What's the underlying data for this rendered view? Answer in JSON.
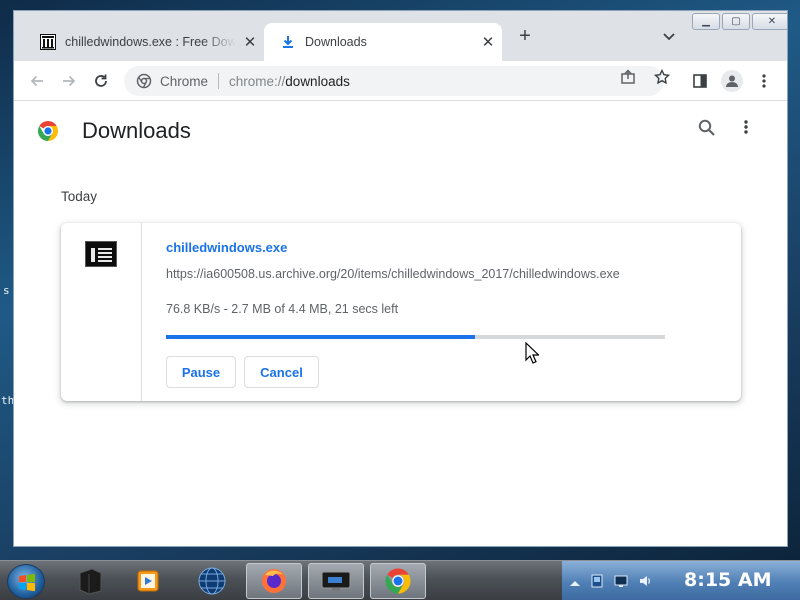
{
  "desktop": {
    "fragments": [
      "s",
      "th"
    ]
  },
  "browser": {
    "tabs": [
      {
        "title": "chilledwindows.exe : Free Download",
        "icon": "archive-icon",
        "active": false
      },
      {
        "title": "Downloads",
        "icon": "download-icon",
        "active": true
      }
    ],
    "omnibox": {
      "chip": "Chrome",
      "scheme": "chrome://",
      "host": "downloads"
    }
  },
  "page": {
    "title": "Downloads",
    "date_group": "Today",
    "download": {
      "file_name": "chilledwindows.exe",
      "url": "https://ia600508.us.archive.org/20/items/chilledwindows_2017/chilledwindows.exe",
      "status": "76.8 KB/s - 2.7 MB of 4.4 MB, 21 secs left",
      "progress_fraction": 0.62,
      "pause_label": "Pause",
      "cancel_label": "Cancel"
    }
  },
  "taskbar": {
    "apps": [
      "file-cabinet-icon",
      "media-player-icon",
      "globe-icon",
      "firefox-icon",
      "remote-desktop-icon",
      "chrome-icon"
    ],
    "clock": "8:15 AM"
  },
  "colors": {
    "accent": "#1a73e8",
    "tabbar": "#dee1e6",
    "progress_track": "#d6d8da"
  }
}
